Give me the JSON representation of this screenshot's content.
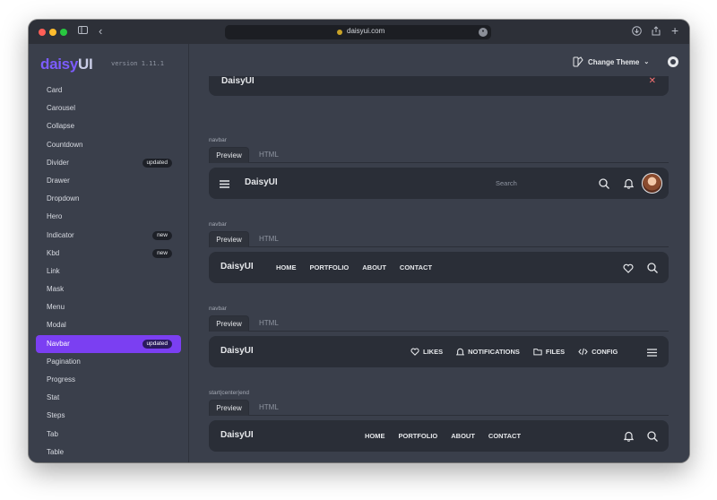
{
  "browser": {
    "url": "daisyui.com"
  },
  "sidebar": {
    "logo_part1": "daisy",
    "logo_part2": "UI",
    "version": "version 1.11.1",
    "items": [
      {
        "label": "Card",
        "badge": ""
      },
      {
        "label": "Carousel",
        "badge": ""
      },
      {
        "label": "Collapse",
        "badge": ""
      },
      {
        "label": "Countdown",
        "badge": ""
      },
      {
        "label": "Divider",
        "badge": "updated"
      },
      {
        "label": "Drawer",
        "badge": ""
      },
      {
        "label": "Dropdown",
        "badge": ""
      },
      {
        "label": "Hero",
        "badge": ""
      },
      {
        "label": "Indicator",
        "badge": "new"
      },
      {
        "label": "Kbd",
        "badge": "new"
      },
      {
        "label": "Link",
        "badge": ""
      },
      {
        "label": "Mask",
        "badge": ""
      },
      {
        "label": "Menu",
        "badge": ""
      },
      {
        "label": "Modal",
        "badge": ""
      },
      {
        "label": "Navbar",
        "badge": "updated",
        "active": true
      },
      {
        "label": "Pagination",
        "badge": ""
      },
      {
        "label": "Progress",
        "badge": ""
      },
      {
        "label": "Stat",
        "badge": ""
      },
      {
        "label": "Steps",
        "badge": ""
      },
      {
        "label": "Tab",
        "badge": ""
      },
      {
        "label": "Table",
        "badge": ""
      }
    ]
  },
  "header": {
    "theme_button": "Change Theme"
  },
  "top_card": {
    "title": "DaisyUI"
  },
  "sections": [
    {
      "label": "navbar",
      "tab_preview": "Preview",
      "tab_html": "HTML",
      "brand": "DaisyUI",
      "search_placeholder": "Search"
    },
    {
      "label": "navbar",
      "tab_preview": "Preview",
      "tab_html": "HTML",
      "brand": "DaisyUI",
      "menu": [
        "HOME",
        "PORTFOLIO",
        "ABOUT",
        "CONTACT"
      ]
    },
    {
      "label": "navbar",
      "tab_preview": "Preview",
      "tab_html": "HTML",
      "brand": "DaisyUI",
      "menu": [
        "LIKES",
        "NOTIFICATIONS",
        "FILES",
        "CONFIG"
      ]
    },
    {
      "label": "start|center|end",
      "tab_preview": "Preview",
      "tab_html": "HTML",
      "brand": "DaisyUI",
      "menu": [
        "HOME",
        "PORTFOLIO",
        "ABOUT",
        "CONTACT"
      ]
    }
  ],
  "colors": {
    "accent": "#7b3ff2",
    "background": "#3a3f4b",
    "navbar_bg": "#2a2e37"
  }
}
